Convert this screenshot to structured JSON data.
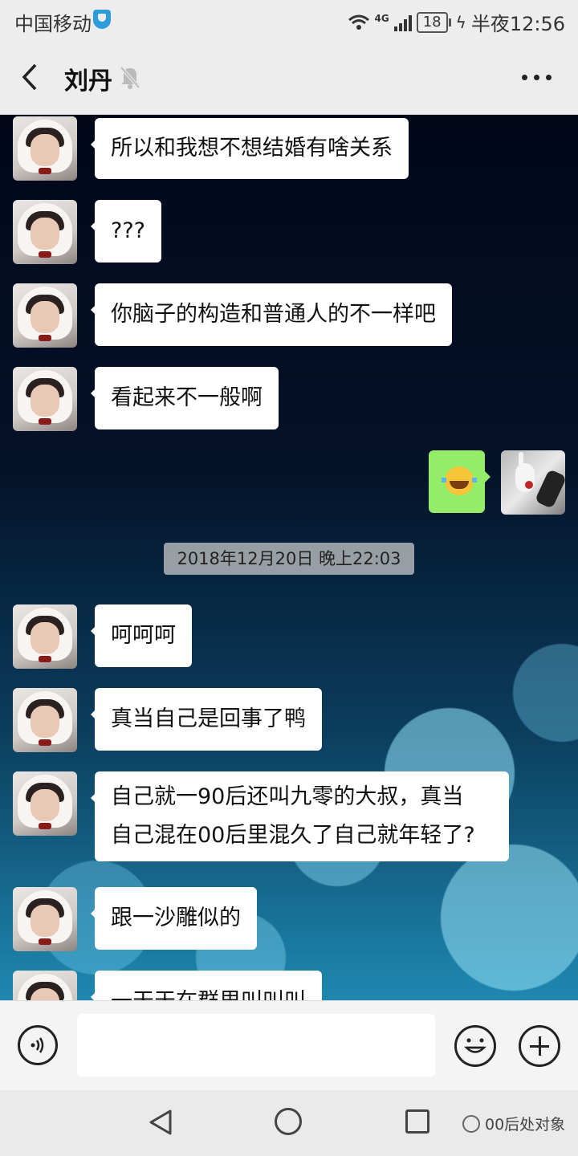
{
  "status_bar": {
    "carrier": "中国移动",
    "network": "4G",
    "battery": "18",
    "time": "半夜12:56"
  },
  "header": {
    "title": "刘丹",
    "icons": {
      "back": "back-arrow-icon",
      "mute": "bell-muted-icon",
      "more": "more-dots-icon"
    }
  },
  "messages": [
    {
      "side": "left",
      "text": "所以和我想不想结婚有啥关系"
    },
    {
      "side": "left",
      "text": "???"
    },
    {
      "side": "left",
      "text": "你脑子的构造和普通人的不一样吧"
    },
    {
      "side": "left",
      "text": "看起来不一般啊"
    },
    {
      "side": "right",
      "emoji": "laughing-tears-emoji"
    }
  ],
  "timestamp": "2018年12月20日 晚上22:03",
  "messages_after": [
    {
      "side": "left",
      "text": "呵呵呵"
    },
    {
      "side": "left",
      "text": "真当自己是回事了鸭"
    },
    {
      "side": "left",
      "lines": [
        "自己就一90后还叫九零的大叔，真当",
        "自己混在00后里混久了自己就年轻了?"
      ]
    },
    {
      "side": "left",
      "text": "跟一沙雕似的"
    },
    {
      "side": "left",
      "text": "一天天在群里叫叫叫"
    }
  ],
  "input_bar": {
    "placeholder": "",
    "icons": {
      "voice": "voice-icon",
      "emoji": "emoji-icon",
      "plus": "plus-icon"
    }
  },
  "watermark": "00后处对象",
  "colors": {
    "sent_bubble": "#95ec69",
    "received_bubble": "#ffffff",
    "bar_bg": "#ededed"
  }
}
